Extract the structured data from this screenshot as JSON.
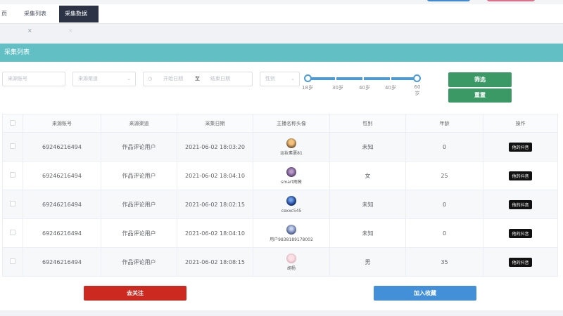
{
  "tabs": {
    "home": "页",
    "list": "采集列表",
    "active": "采集数据",
    "close": "×"
  },
  "panel": {
    "title": "采集列表"
  },
  "filters": {
    "account_placeholder": "来源账号",
    "channel_placeholder": "来源渠道",
    "date_start_placeholder": "开始日期",
    "date_separator": "至",
    "date_end_placeholder": "结束日期",
    "gender_placeholder": "性别",
    "arrow": "⌄",
    "clock": "◷"
  },
  "age_slider": {
    "min": 18,
    "max": 60,
    "value_low": 18,
    "value_high": 60,
    "labels": [
      "18岁",
      "30岁",
      "40岁",
      "40岁",
      "60\n岁"
    ]
  },
  "buttons": {
    "filter": "筛选",
    "reset": "重置",
    "unfollow": "去关注",
    "collect": "加入收藏"
  },
  "table": {
    "headers": [
      "来源账号",
      "来源渠道",
      "采集日期",
      "主播名称头像",
      "性别",
      "年龄",
      "操作"
    ],
    "rows": [
      {
        "account": "69246216494",
        "channel": "作品评论用户",
        "date": "2021-06-02 18:03:20",
        "anchor": "淡妆素裹81",
        "gender": "未知",
        "age": "0",
        "op": "他的抖音"
      },
      {
        "account": "69246216494",
        "channel": "作品评论用户",
        "date": "2021-06-02 18:04:10",
        "anchor": "smart雨薇",
        "gender": "女",
        "age": "25",
        "op": "他的抖音"
      },
      {
        "account": "69246216494",
        "channel": "作品评论用户",
        "date": "2021-06-02 18:02:15",
        "anchor": "cexxc545",
        "gender": "未知",
        "age": "0",
        "op": "他的抖音"
      },
      {
        "account": "69246216494",
        "channel": "作品评论用户",
        "date": "2021-06-02 18:04:10",
        "anchor": "用户9838189178002",
        "gender": "未知",
        "age": "0",
        "op": "他的抖音"
      },
      {
        "account": "69246216494",
        "channel": "作品评论用户",
        "date": "2021-06-02 18:08:15",
        "anchor": "胡杨",
        "gender": "男",
        "age": "35",
        "op": "他的抖音"
      }
    ]
  },
  "colors": {
    "panel_header": "#62c0c5",
    "active_tab": "#2b3344",
    "filter_button": "#3b9966",
    "unfollow_button": "#cc2a20",
    "collect_button": "#4390d8",
    "slider": "#4b9bd8"
  }
}
